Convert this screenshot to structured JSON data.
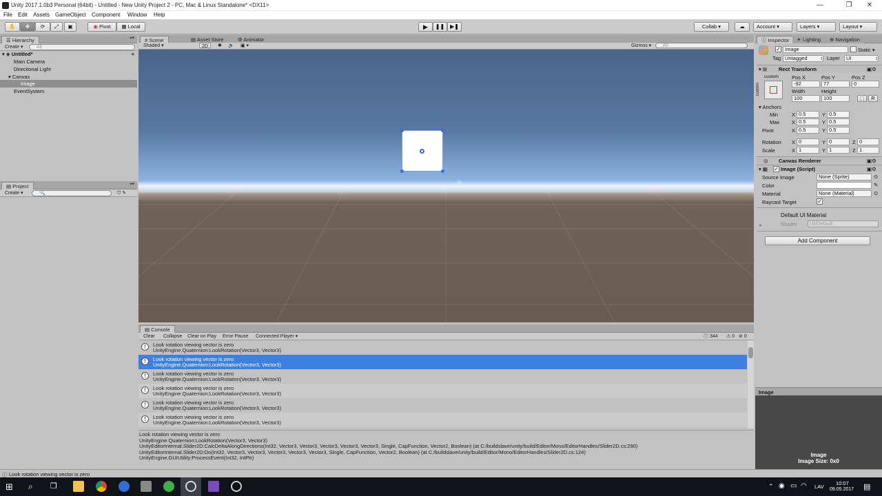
{
  "window": {
    "title": "Unity 2017.1.0b3 Personal (64bit) - Untitled - New Unity Project 2 - PC, Mac & Linux Standalone* <DX11>",
    "minimize": "—",
    "maximize": "❐",
    "close": "✕"
  },
  "menu": [
    "File",
    "Edit",
    "Assets",
    "GameObject",
    "Component",
    "Window",
    "Help"
  ],
  "toolbar": {
    "pivot": "Pivot",
    "local": "Local",
    "collab": "Collab ▾",
    "account": "Account",
    "layers": "Layers",
    "layout": "Layout"
  },
  "hierarchy": {
    "tab": "Hierarchy",
    "create": "Create ▾",
    "search_placeholder": "All",
    "scene": "Untitled*",
    "items": [
      "Main Camera",
      "Directional Light",
      "Canvas",
      "Image",
      "EventSystem"
    ]
  },
  "project": {
    "tab": "Project",
    "create": "Create ▾"
  },
  "scene": {
    "tabs": [
      "Scene",
      "Asset Store",
      "Animator"
    ],
    "shading": "Shaded",
    "mode2d": "2D",
    "gizmos": "Gizmos ▾",
    "search_placeholder": "All"
  },
  "console": {
    "tab": "Console",
    "buttons": [
      "Clear",
      "Collapse",
      "Clear on Play",
      "Error Pause",
      "Connected Player ▾"
    ],
    "counts": {
      "log": "344",
      "warn": "0",
      "error": "0"
    },
    "rows": [
      {
        "l1": "Look rotation viewing vector is zero",
        "l2": "UnityEngine.Quaternion:LookRotation(Vector3, Vector3)"
      },
      {
        "l1": "Look rotation viewing vector is zero",
        "l2": "UnityEngine.Quaternion:LookRotation(Vector3, Vector3)"
      },
      {
        "l1": "Look rotation viewing vector is zero",
        "l2": "UnityEngine.Quaternion:LookRotation(Vector3, Vector3)"
      },
      {
        "l1": "Look rotation viewing vector is zero",
        "l2": "UnityEngine.Quaternion:LookRotation(Vector3, Vector3)"
      },
      {
        "l1": "Look rotation viewing vector is zero",
        "l2": "UnityEngine.Quaternion:LookRotation(Vector3, Vector3)"
      },
      {
        "l1": "Look rotation viewing vector is zero",
        "l2": "UnityEngine.Quaternion:LookRotation(Vector3, Vector3)"
      }
    ],
    "detail": [
      "Look rotation viewing vector is zero",
      "UnityEngine.Quaternion:LookRotation(Vector3, Vector3)",
      "UnityEditorInternal.Slider2D:CalcDeltaAlongDirections(Int32, Vector3, Vector3, Vector3, Vector3, Vector3, Single, CapFunction, Vector2, Boolean) (at C:/buildslave/unity/build/Editor/Mono/EditorHandles/Slider2D.cs:290)",
      "UnityEditorInternal.Slider2D:Do(Int32, Vector3, Vector3, Vector3, Vector3, Vector3, Single, CapFunction, Vector2, Boolean) (at C:/buildslave/unity/build/Editor/Mono/EditorHandles/Slider2D.cs:124)",
      "UnityEngine.GUIUtility:ProcessEvent(Int32, IntPtr)"
    ],
    "status": "Look rotation viewing vector is zero"
  },
  "inspector": {
    "tabs": [
      "Inspector",
      "Lighting",
      "Navigation"
    ],
    "name": "Image",
    "static": "Static ▾",
    "tag_label": "Tag",
    "tag": "Untagged",
    "layer_label": "Layer",
    "layer": "UI",
    "rect": {
      "title": "Rect Transform",
      "preset": "custom",
      "side": "custom",
      "posx_label": "Pos X",
      "posy_label": "Pos Y",
      "posz_label": "Pos Z",
      "posx": "-92",
      "posy": "77",
      "posz": "0",
      "width_label": "Width",
      "height_label": "Height",
      "width": "100",
      "height": "100",
      "r": "R",
      "anchors": "Anchors",
      "min": "Min",
      "max": "Max",
      "pivot": "Pivot",
      "min_x": "0.5",
      "min_y": "0.5",
      "max_x": "0.5",
      "max_y": "0.5",
      "pivot_x": "0.5",
      "pivot_y": "0.5",
      "rotation": "Rotation",
      "scale": "Scale",
      "rot_x": "0",
      "rot_y": "0",
      "rot_z": "0",
      "scale_x": "1",
      "scale_y": "1",
      "scale_z": "1",
      "x": "X",
      "y": "Y",
      "z": "Z"
    },
    "canvas_renderer": "Canvas Renderer",
    "image_script": {
      "title": "Image (Script)",
      "source_label": "Source Image",
      "source": "None (Sprite)",
      "color_label": "Color",
      "material_label": "Material",
      "material": "None (Material)",
      "raycast_label": "Raycast Target"
    },
    "material": {
      "name": "Default UI Material",
      "shader_label": "Shader",
      "shader": "UI/Default"
    },
    "add_component": "Add Component",
    "preview_title": "Image",
    "preview_name": "Image",
    "preview_size": "Image Size: 0x0"
  },
  "taskbar": {
    "time": "10:07",
    "date": "09.05.2017",
    "lang": "LAV"
  }
}
